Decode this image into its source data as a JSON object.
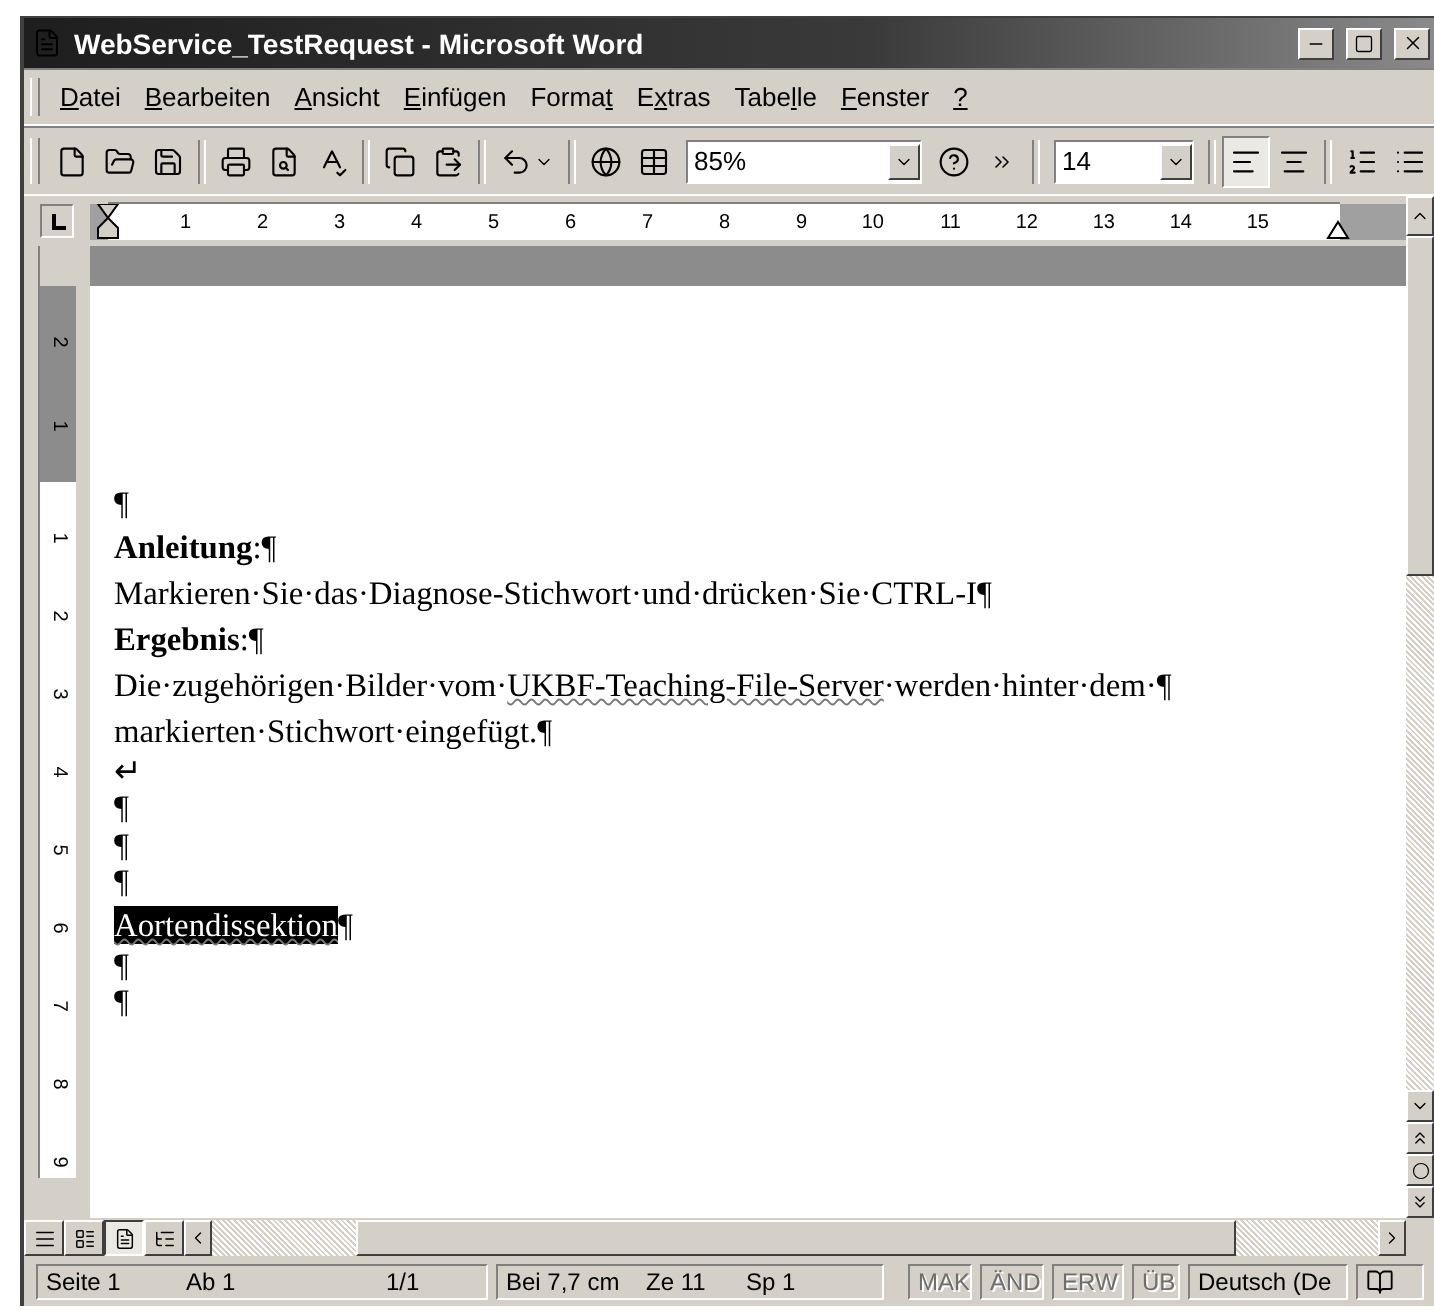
{
  "window": {
    "title": "WebService_TestRequest - Microsoft Word"
  },
  "menu": [
    {
      "key": "D",
      "post": "atei"
    },
    {
      "key": "B",
      "post": "earbeiten"
    },
    {
      "key": "A",
      "post": "nsicht"
    },
    {
      "key": "E",
      "post": "infügen"
    },
    {
      "pre": "Forma",
      "key": "t"
    },
    {
      "pre": "E",
      "key": "x",
      "post": "tras"
    },
    {
      "pre": "Tabe",
      "key": "l",
      "post": "le"
    },
    {
      "key": "F",
      "post": "enster"
    },
    {
      "key": "?"
    }
  ],
  "toolbar": {
    "zoom": "85%",
    "font_size": "14",
    "align": [
      {
        "selected": true
      },
      {
        "selected": false
      }
    ]
  },
  "ruler": {
    "h_ticks": [
      "1",
      "2",
      "3",
      "4",
      "5",
      "6",
      "7",
      "8",
      "9",
      "10",
      "11",
      "12",
      "13",
      "14",
      "15"
    ],
    "v_margin_ticks": [
      "2",
      "1"
    ],
    "v_ticks": [
      "1",
      "2",
      "3",
      "4",
      "5",
      "6",
      "7",
      "8",
      "9"
    ]
  },
  "document": {
    "lines": [
      {
        "kind": "mark",
        "parts": [
          {
            "text": "¶"
          }
        ]
      },
      {
        "kind": "text",
        "parts": [
          {
            "text": "**Anleitung**:¶"
          }
        ]
      },
      {
        "kind": "text",
        "parts": [
          {
            "text": "Markieren·Sie·das·Diagnose-Stichwort·und·drücken·Sie·CTRL-I¶"
          }
        ]
      },
      {
        "kind": "text",
        "parts": [
          {
            "text": "**Ergebnis**:¶"
          }
        ]
      },
      {
        "kind": "text",
        "parts": [
          {
            "text": "Die·zugehörigen·Bilder·vom·"
          },
          {
            "text": "UKBF-Teaching-File-Server",
            "misspelled": true
          },
          {
            "text": "·werden·hinter·dem·¶"
          }
        ]
      },
      {
        "kind": "text",
        "parts": [
          {
            "text": "markierten·Stichwort·eingefügt.¶"
          }
        ]
      },
      {
        "kind": "mark",
        "parts": [
          {
            "text": "↵"
          }
        ]
      },
      {
        "kind": "mark",
        "parts": [
          {
            "text": "¶"
          }
        ]
      },
      {
        "kind": "mark",
        "parts": [
          {
            "text": "¶"
          }
        ]
      },
      {
        "kind": "mark",
        "parts": [
          {
            "text": "¶"
          }
        ]
      },
      {
        "kind": "text",
        "parts": [
          {
            "text": "Aortendissektion",
            "misspelled": true,
            "selected": true
          },
          {
            "text": "¶"
          }
        ]
      },
      {
        "kind": "mark",
        "parts": [
          {
            "text": "¶"
          }
        ]
      },
      {
        "kind": "mark",
        "parts": [
          {
            "text": "¶"
          }
        ]
      }
    ]
  },
  "view_buttons": [
    {
      "selected": false
    },
    {
      "selected": false
    },
    {
      "selected": true
    },
    {
      "selected": false
    }
  ],
  "status_bar": {
    "panels": [
      {
        "items": [
          "Seite 1",
          "Ab 1",
          "1/1"
        ]
      },
      {
        "items": [
          "Bei 7,7 cm",
          "Ze 11",
          "Sp 1"
        ]
      }
    ],
    "modes": [
      {
        "text": "MAK",
        "active": false
      },
      {
        "text": "ÄND",
        "active": false
      },
      {
        "text": "ERW",
        "active": false
      },
      {
        "text": "ÜB",
        "active": false
      }
    ],
    "language": "Deutsch (De"
  }
}
